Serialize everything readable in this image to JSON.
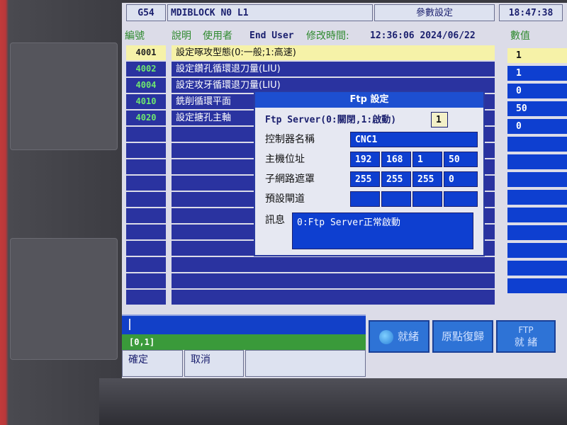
{
  "topbar": {
    "mode": "G54",
    "block": "MDIBLOCK N0 L1",
    "title": "參數設定",
    "clock": "18:47:38"
  },
  "headers": {
    "id": "編號",
    "desc": "說明",
    "user": "使用者",
    "end_user": "End User",
    "modified_label": "修改時間:",
    "modified_time": "12:36:06 2024/06/22",
    "value": "數值"
  },
  "params": [
    {
      "id": "4001",
      "desc": "設定啄攻型態(0:一般;1:高速)",
      "value": "1"
    },
    {
      "id": "4002",
      "desc": "設定鑽孔循環退刀量(LIU)",
      "value": "1"
    },
    {
      "id": "4004",
      "desc": "設定攻牙循環退刀量(LIU)",
      "value": "0"
    },
    {
      "id": "4010",
      "desc": "銑削循環平面",
      "value": "50"
    },
    {
      "id": "4020",
      "desc": "設定搪孔主軸",
      "value": "0"
    }
  ],
  "dialog": {
    "title": "Ftp 設定",
    "server_label": "Ftp Server(0:關閉,1:啟動)",
    "server_value": "1",
    "name_label": "控制器名稱",
    "name_value": "CNC1",
    "ip_label": "主機位址",
    "ip": [
      "192",
      "168",
      "1",
      "50"
    ],
    "mask_label": "子網路遮罩",
    "mask": [
      "255",
      "255",
      "255",
      "0"
    ],
    "gateway_label": "預設閘道",
    "gateway": [
      "",
      "",
      "",
      ""
    ],
    "msg_label": "訊息",
    "msg_value": "0:Ftp Server正常啟動"
  },
  "bottom": {
    "coord": "[0,1]",
    "confirm": "確定",
    "cancel": "取消",
    "ready": "就緒",
    "home": "原點復歸",
    "ftp_top": "FTP",
    "ftp_bottom": "就 緒"
  }
}
